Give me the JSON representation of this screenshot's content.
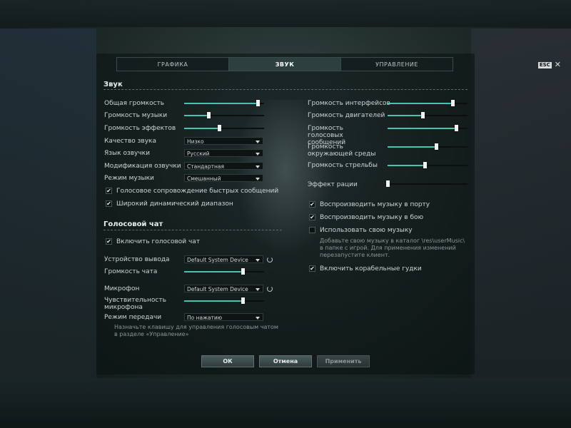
{
  "tabs": [
    {
      "label": "ГРАФИКА"
    },
    {
      "label": "ЗВУК"
    },
    {
      "label": "УПРАВЛЕНИЕ"
    }
  ],
  "esc_label": "ESC",
  "close_icon": "close-icon",
  "sound": {
    "title": "Звук",
    "left_sliders": [
      {
        "label": "Общая громкость",
        "value": 0.92
      },
      {
        "label": "Громкость музыки",
        "value": 0.3
      },
      {
        "label": "Громкость эффектов",
        "value": 0.44
      }
    ],
    "dropdowns": [
      {
        "label": "Качество звука",
        "value": "Низко"
      },
      {
        "label": "Язык озвучки",
        "value": "Русский"
      },
      {
        "label": "Модификация озвучки",
        "value": "Стандартная"
      },
      {
        "label": "Режим музыки",
        "value": "Смешанный"
      }
    ],
    "left_checks": [
      {
        "label": "Голосовое сопровождение быстрых сообщений",
        "checked": true
      },
      {
        "label": "Широкий динамический диапазон",
        "checked": true
      }
    ],
    "right_sliders": [
      {
        "label": "Громкость интерфейсов",
        "value": 0.81
      },
      {
        "label": "Громкость двигателей",
        "value": 0.44
      },
      {
        "label": "Громкость голосовых сообщений",
        "value": 0.86
      },
      {
        "label": "Громкость окружающей среды",
        "value": 0.61
      },
      {
        "label": "Громкость стрельбы",
        "value": 0.46
      },
      {
        "label": "Эффект рации",
        "value": 0.0
      }
    ],
    "right_checks": [
      {
        "label": "Воспроизводить музыку в порту",
        "checked": true
      },
      {
        "label": "Воспроизводить музыку в бою",
        "checked": true
      },
      {
        "label": "Использовать свою музыку",
        "checked": false
      },
      {
        "label": "Включить корабельные гудки",
        "checked": true
      }
    ],
    "custom_music_hint_lines": [
      "Добавьте свою музыку в каталог \\res\\userMusic\\",
      "в папке с игрой. Для применения изменений",
      "перезапустите клиент."
    ]
  },
  "voice": {
    "title": "Голосовой чат",
    "enable_label": "Включить голосовой чат",
    "enable_checked": true,
    "output_label": "Устройство вывода",
    "output_value": "Default System Device",
    "chat_volume_label": "Громкость чата",
    "chat_volume": 0.73,
    "mic_label": "Микрофон",
    "mic_value": "Default System Device",
    "sensitivity_label_lines": [
      "Чувствительность",
      "микрофона"
    ],
    "sensitivity": 0.73,
    "mode_label": "Режим передачи",
    "mode_value": "По нажатию",
    "hint_lines": [
      "Назначьте клавишу для управления голосовым чатом",
      "в разделе «Управление»"
    ]
  },
  "buttons": {
    "ok": "ОК",
    "cancel": "Отмена",
    "apply": "Применить"
  },
  "colors": {
    "accent": "#45c4b0",
    "background": "#1b2626"
  }
}
